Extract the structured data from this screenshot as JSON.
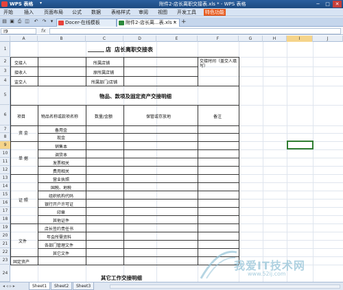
{
  "titlebar": {
    "app_name": "WPS 表格",
    "dropdown_glyph": "▾",
    "document_title": "附件2-店长离职交接表.xls * - WPS 表格",
    "minimize_glyph": "─",
    "maximize_glyph": "□",
    "close_glyph": "✕"
  },
  "menu": {
    "items": [
      "开始",
      "插入",
      "页面布局",
      "公式",
      "数据",
      "表格样式",
      "审阅",
      "视图",
      "开发工具"
    ],
    "special": "特色功能"
  },
  "tabs": {
    "docer": "Docer-在线模板",
    "file": "附件2-店长离...表.xls *",
    "close_glyph": "×",
    "plus_glyph": "+"
  },
  "formula": {
    "cell_ref": "I9",
    "fx_label": "fx",
    "value": ""
  },
  "columns": [
    "A",
    "B",
    "C",
    "D",
    "E",
    "F",
    "G",
    "H",
    "I",
    "J"
  ],
  "selected_column": "I",
  "rows": [
    "1",
    "2",
    "3",
    "4",
    "5",
    "6",
    "7",
    "8",
    "9",
    "10",
    "11",
    "12",
    "13",
    "14",
    "15",
    "16",
    "17",
    "18",
    "19",
    "20",
    "21",
    "22",
    "23",
    "24"
  ],
  "selected_row": "9",
  "sheet": {
    "title_prefix": "店",
    "title_suffix": "店长离职交接表",
    "r2": {
      "a": "交接人",
      "c": "所属店铺",
      "f": "交接时间（盖交人填写）"
    },
    "r3": {
      "a": "接收人",
      "c": "原所属店铺"
    },
    "r4": {
      "a": "监交人",
      "c": "所属部门/店铺"
    },
    "section1": "物品、款项及固定资产交接明细",
    "headers": {
      "a": "项目",
      "b": "物品名称或款项名称",
      "c": "数量/金额",
      "d": "保管或存放地",
      "f": "备注"
    },
    "group_cash": "资 金",
    "cash_items": [
      "备用金",
      "现金"
    ],
    "group_docs": "单 据",
    "doc_items": [
      "销售本",
      "调货本",
      "发票相关",
      "费用相关"
    ],
    "group_cert": "证 照",
    "cert_items": [
      "营业执照",
      "国税、地税",
      "组织机构代码",
      "银行开户许可证",
      "印章",
      "其他证件"
    ],
    "group_files": "文件",
    "file_items": [
      "店长签约责任书",
      "年会所需资料",
      "各部门管理文件",
      "其它文件"
    ],
    "fixed_assets": "固定资产",
    "section2": "其它工作交接明细"
  },
  "sheet_nav": "◂ ◃ ▹ ▸",
  "sheet_tabs": [
    "Sheet1",
    "Sheet2",
    "Sheet3"
  ],
  "watermark": {
    "main": "我爱IT技术网",
    "sub": "www.52ij.com"
  }
}
